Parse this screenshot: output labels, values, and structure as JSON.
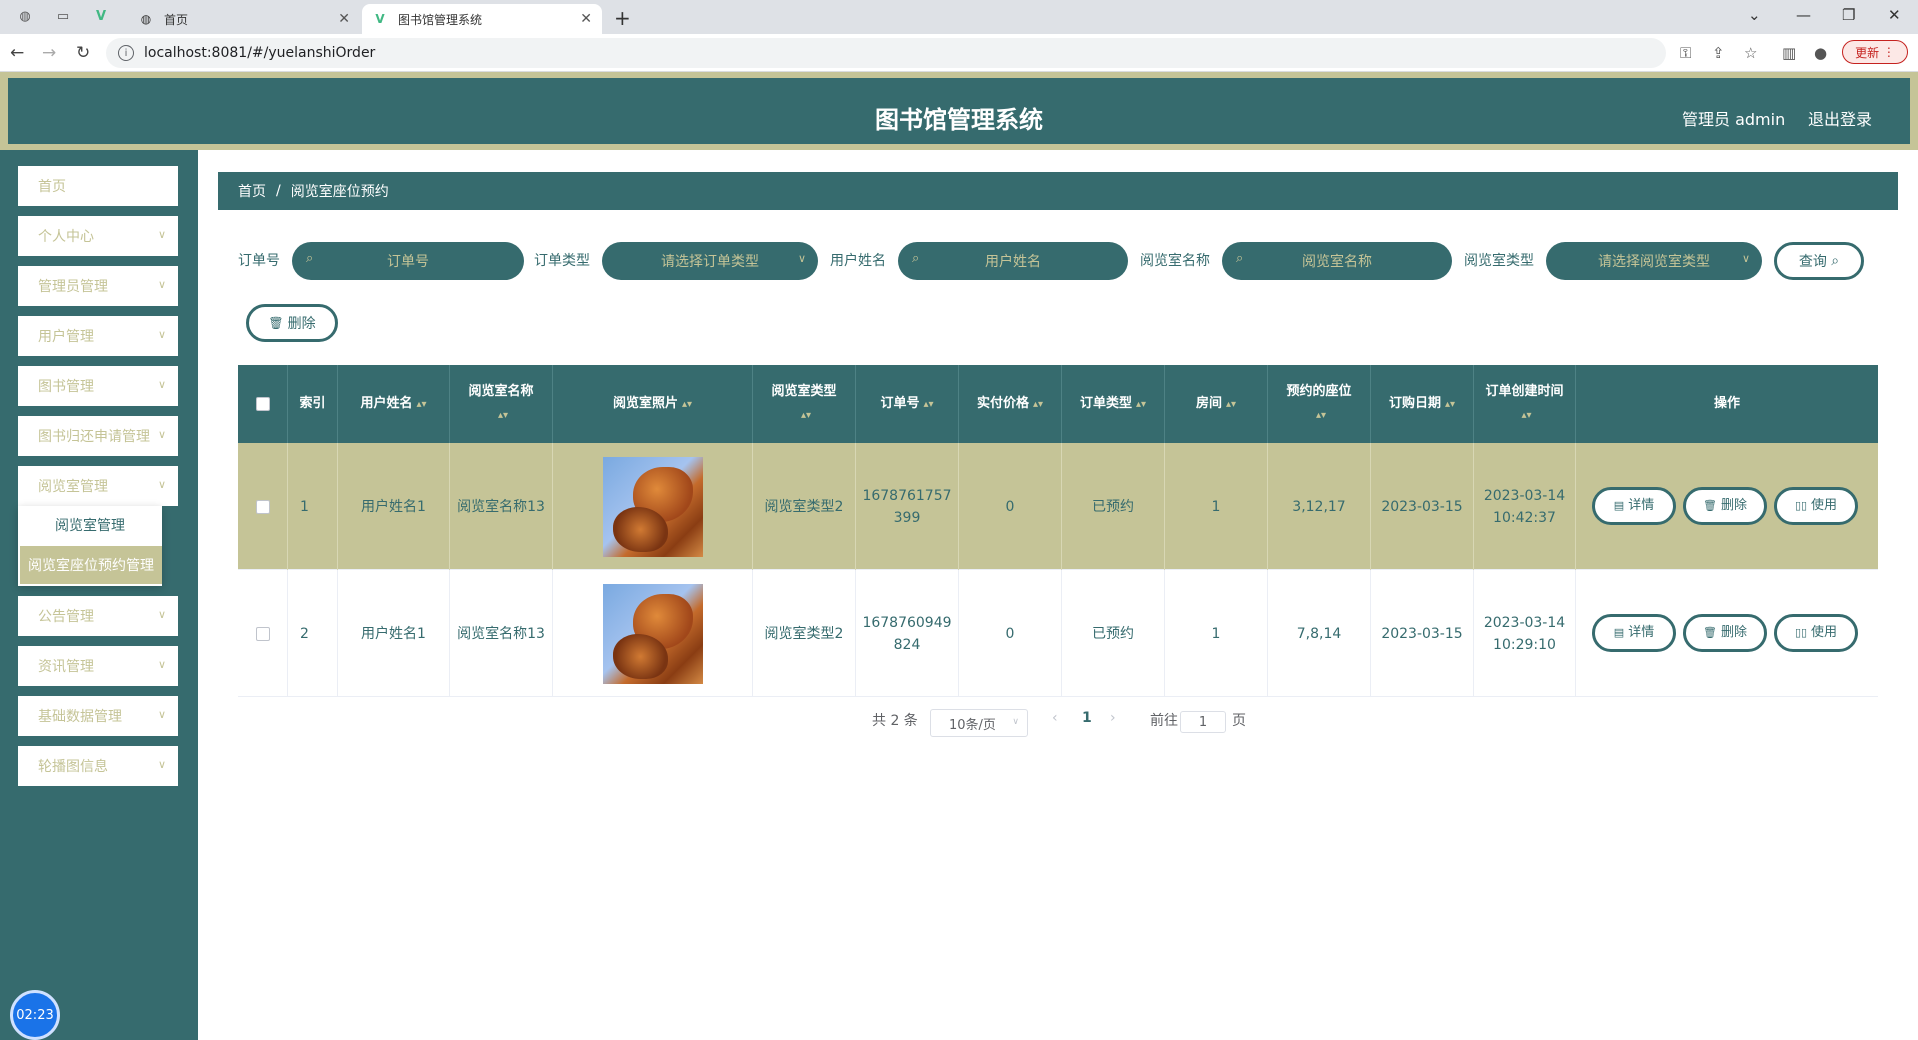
{
  "browser": {
    "tabs": [
      {
        "title": "首页",
        "active": false
      },
      {
        "title": "图书馆管理系统",
        "active": true
      }
    ],
    "url": "localhost:8081/#/yuelanshiOrder",
    "update_label": "更新"
  },
  "header": {
    "title": "图书馆管理系统",
    "admin": "管理员 admin",
    "logout": "退出登录",
    "colors": {
      "primary": "#366b6e",
      "accent": "#c5c497"
    }
  },
  "sidebar": {
    "items": [
      {
        "label": "首页",
        "has_children": false
      },
      {
        "label": "个人中心",
        "has_children": true
      },
      {
        "label": "管理员管理",
        "has_children": true
      },
      {
        "label": "用户管理",
        "has_children": true
      },
      {
        "label": "图书管理",
        "has_children": true
      },
      {
        "label": "图书归还申请管理",
        "has_children": true
      },
      {
        "label": "阅览室管理",
        "has_children": true
      },
      {
        "label": "公告管理",
        "has_children": true
      },
      {
        "label": "资讯管理",
        "has_children": true
      },
      {
        "label": "基础数据管理",
        "has_children": true
      },
      {
        "label": "轮播图信息",
        "has_children": true
      }
    ],
    "submenu": [
      "阅览室管理",
      "阅览室座位预约管理"
    ],
    "clock": "02:23"
  },
  "breadcrumb": {
    "home": "首页",
    "sep": "/",
    "current": "阅览室座位预约"
  },
  "filters": {
    "order_no_label": "订单号",
    "order_no_placeholder": "订单号",
    "order_type_label": "订单类型",
    "order_type_placeholder": "请选择订单类型",
    "user_name_label": "用户姓名",
    "user_name_placeholder": "用户姓名",
    "room_name_label": "阅览室名称",
    "room_name_placeholder": "阅览室名称",
    "room_type_label": "阅览室类型",
    "room_type_placeholder": "请选择阅览室类型",
    "query_label": "查询"
  },
  "toolbar": {
    "delete_label": "删除"
  },
  "table": {
    "headers": {
      "index": "索引",
      "user_name": "用户姓名",
      "room_name": "阅览室名称",
      "room_photo": "阅览室照片",
      "room_type": "阅览室类型",
      "order_no": "订单号",
      "price": "实付价格",
      "order_type": "订单类型",
      "room": "房间",
      "seats": "预约的座位",
      "order_date": "订购日期",
      "created": "订单创建时间",
      "ops": "操作"
    },
    "rows": [
      {
        "index": "1",
        "user_name": "用户姓名1",
        "room_name": "阅览室名称13",
        "room_type": "阅览室类型2",
        "order_no": "1678761757399",
        "price": "0",
        "order_type": "已预约",
        "room": "1",
        "seats": "3,12,17",
        "order_date": "2023-03-15",
        "created_date": "2023-03-14",
        "created_time": "10:42:37"
      },
      {
        "index": "2",
        "user_name": "用户姓名1",
        "room_name": "阅览室名称13",
        "room_type": "阅览室类型2",
        "order_no": "1678760949824",
        "price": "0",
        "order_type": "已预约",
        "room": "1",
        "seats": "7,8,14",
        "order_date": "2023-03-15",
        "created_date": "2023-03-14",
        "created_time": "10:29:10"
      }
    ],
    "actions": {
      "detail": "详情",
      "delete": "删除",
      "use": "使用"
    }
  },
  "pagination": {
    "total": "共 2 条",
    "page_size": "10条/页",
    "current": "1",
    "goto_prefix": "前往",
    "goto_value": "1",
    "goto_suffix": "页"
  }
}
